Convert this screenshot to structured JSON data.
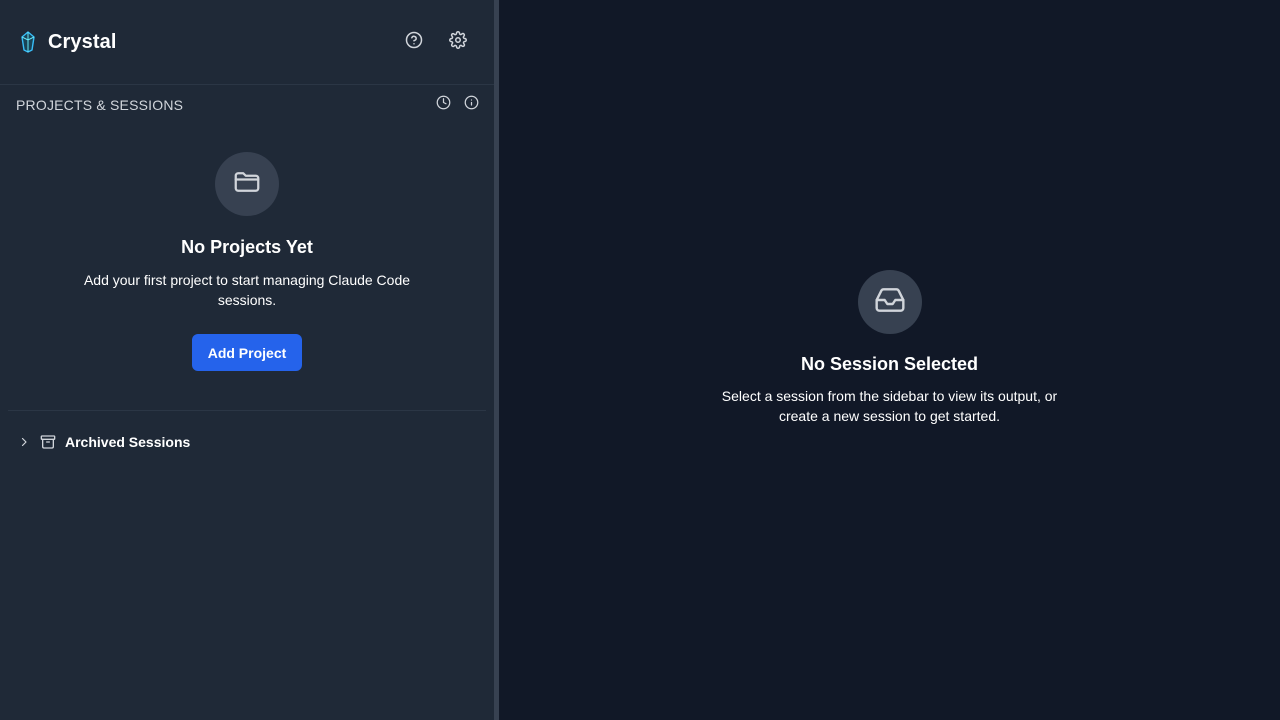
{
  "sidebar": {
    "app_title": "Crystal",
    "logo_icon": "crystal-logo-icon",
    "header_icons": [
      "help-circle-icon",
      "gear-icon"
    ],
    "section_title": "PROJECTS & SESSIONS",
    "section_icons": [
      "clock-icon",
      "info-icon"
    ],
    "empty_state": {
      "icon": "folder-icon",
      "title": "No Projects Yet",
      "text": "Add your first project to start managing Claude Code sessions.",
      "button_label": "Add Project"
    },
    "archived": {
      "label": "Archived Sessions",
      "expanded": false
    }
  },
  "main": {
    "empty_state": {
      "icon": "inbox-icon",
      "title": "No Session Selected",
      "text": "Select a session from the sidebar to view its output, or create a new session to get started."
    }
  },
  "colors": {
    "sidebar_bg": "#1f2937",
    "main_bg": "#111827",
    "accent": "#2563eb",
    "icon_circle": "#374151"
  }
}
